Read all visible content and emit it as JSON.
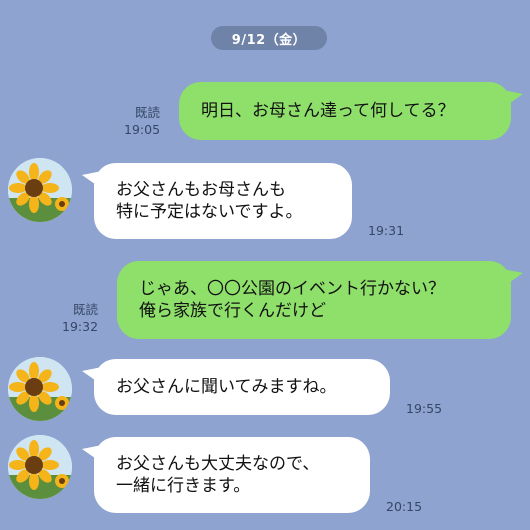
{
  "date_label": "9/12（金）",
  "messages": [
    {
      "from": "me",
      "lines": [
        "明日、お母さん達って何してる？"
      ],
      "read": "既読",
      "time": "19:05"
    },
    {
      "from": "other",
      "lines": [
        "お父さんもお母さんも",
        "特に予定はないですよ。"
      ],
      "time": "19:31",
      "avatar": "sunflower-icon"
    },
    {
      "from": "me",
      "lines": [
        "じゃあ、〇〇公園のイベント行かない？",
        "俺ら家族で行くんだけど"
      ],
      "read": "既読",
      "time": "19:32"
    },
    {
      "from": "other",
      "lines": [
        "お父さんに聞いてみますね。"
      ],
      "time": "19:55",
      "avatar": "sunflower-icon"
    },
    {
      "from": "other",
      "lines": [
        "お父さんも大丈夫なので、",
        "一緒に行きます。"
      ],
      "time": "20:15",
      "avatar": "sunflower-icon"
    }
  ],
  "colors": {
    "background": "#8ea3cf",
    "outgoing_bubble": "#8fe06b",
    "incoming_bubble": "#ffffff",
    "date_pill": "#6f82a8"
  }
}
